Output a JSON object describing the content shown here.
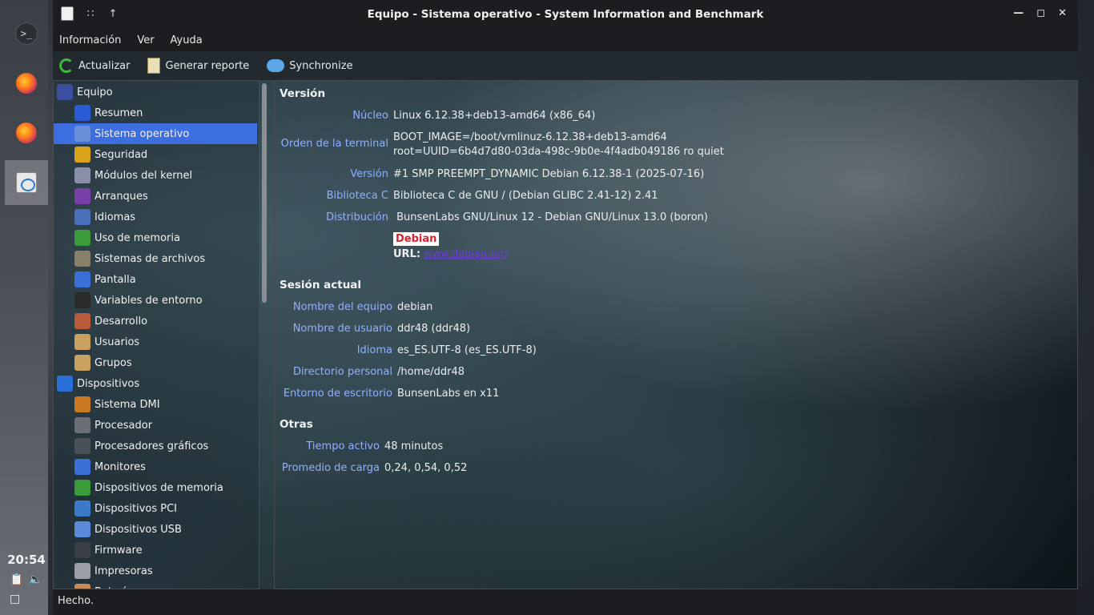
{
  "dock": {
    "clock": "20:54"
  },
  "window": {
    "title": "Equipo - Sistema operativo - System Information and Benchmark"
  },
  "menu": [
    "Información",
    "Ver",
    "Ayuda"
  ],
  "toolbar": {
    "refresh": "Actualizar",
    "report": "Generar reporte",
    "sync": "Synchronize"
  },
  "tree": [
    {
      "label": "Equipo",
      "level": "cat",
      "icon": "computer-icon",
      "color": "#3b4ea0"
    },
    {
      "label": "Resumen",
      "level": "sub",
      "icon": "info-icon",
      "color": "#2a5bd7"
    },
    {
      "label": "Sistema operativo",
      "level": "sub",
      "icon": "os-icon",
      "color": "#6a8fd8",
      "selected": true
    },
    {
      "label": "Seguridad",
      "level": "sub",
      "icon": "shield-icon",
      "color": "#d9a21b"
    },
    {
      "label": "Módulos del kernel",
      "level": "sub",
      "icon": "module-icon",
      "color": "#8a8fa8"
    },
    {
      "label": "Arranques",
      "level": "sub",
      "icon": "rocket-icon",
      "color": "#7a3fa8"
    },
    {
      "label": "Idiomas",
      "level": "sub",
      "icon": "language-icon",
      "color": "#4a6fb8"
    },
    {
      "label": "Uso de memoria",
      "level": "sub",
      "icon": "memory-icon",
      "color": "#3a9a3a"
    },
    {
      "label": "Sistemas de archivos",
      "level": "sub",
      "icon": "filesystem-icon",
      "color": "#8a7f6a"
    },
    {
      "label": "Pantalla",
      "level": "sub",
      "icon": "display-icon",
      "color": "#3a6fd8"
    },
    {
      "label": "Variables de entorno",
      "level": "sub",
      "icon": "terminal-icon",
      "color": "#2a2a2a"
    },
    {
      "label": "Desarrollo",
      "level": "sub",
      "icon": "development-icon",
      "color": "#b85a3a"
    },
    {
      "label": "Usuarios",
      "level": "sub",
      "icon": "users-icon",
      "color": "#c9a060"
    },
    {
      "label": "Grupos",
      "level": "sub",
      "icon": "groups-icon",
      "color": "#c9a060"
    },
    {
      "label": "Dispositivos",
      "level": "cat",
      "icon": "devices-icon",
      "color": "#2a6fd8"
    },
    {
      "label": "Sistema DMI",
      "level": "sub",
      "icon": "gears-icon",
      "color": "#c97a20"
    },
    {
      "label": "Procesador",
      "level": "sub",
      "icon": "cpu-icon",
      "color": "#6a6f75"
    },
    {
      "label": "Procesadores gráficos",
      "level": "sub",
      "icon": "gpu-icon",
      "color": "#4a5058"
    },
    {
      "label": "Monitores",
      "level": "sub",
      "icon": "monitor-icon",
      "color": "#3a6fd8"
    },
    {
      "label": "Dispositivos de memoria",
      "level": "sub",
      "icon": "memory-device-icon",
      "color": "#3a9a3a"
    },
    {
      "label": "Dispositivos PCI",
      "level": "sub",
      "icon": "pci-icon",
      "color": "#3a7ac8"
    },
    {
      "label": "Dispositivos USB",
      "level": "sub",
      "icon": "usb-icon",
      "color": "#5a8ad8"
    },
    {
      "label": "Firmware",
      "level": "sub",
      "icon": "firmware-icon",
      "color": "#3a3f45"
    },
    {
      "label": "Impresoras",
      "level": "sub",
      "icon": "printer-icon",
      "color": "#9a9fa5"
    },
    {
      "label": "Baterías",
      "level": "sub",
      "icon": "battery-icon",
      "color": "#c98a5a"
    }
  ],
  "info": {
    "version_title": "Versión",
    "nucleo_label": "Núcleo",
    "nucleo_value": "Linux 6.12.38+deb13-amd64 (x86_64)",
    "cmdline_label": "Orden de la terminal",
    "cmdline_line1": "BOOT_IMAGE=/boot/vmlinuz-6.12.38+deb13-amd64",
    "cmdline_line2": "root=UUID=6b4d7d80-03da-498c-9b0e-4f4adb049186 ro quiet",
    "version_label": "Versión",
    "version_value": "#1 SMP PREEMPT_DYNAMIC Debian 6.12.38-1 (2025-07-16)",
    "libc_label": "Biblioteca C",
    "libc_value": "Biblioteca C de GNU / (Debian GLIBC 2.41-12) 2.41",
    "distro_label": "Distribución",
    "distro_value": " BunsenLabs GNU/Linux 12 - Debian GNU/Linux 13.0 (boron)",
    "debian_badge": "Debian",
    "url_label": "URL:",
    "url_value": "www.debian.org",
    "session_title": "Sesión actual",
    "hostname_label": "Nombre del equipo",
    "hostname_value": "debian",
    "username_label": "Nombre de usuario",
    "username_value": "ddr48 (ddr48)",
    "locale_label": "Idioma",
    "locale_value": "es_ES.UTF-8 (es_ES.UTF-8)",
    "home_label": "Directorio personal",
    "home_value": "/home/ddr48",
    "desktop_label": "Entorno de escritorio",
    "desktop_value": "BunsenLabs en x11",
    "other_title": "Otras",
    "uptime_label": "Tiempo activo",
    "uptime_value": "48 minutos",
    "load_label": "Promedio de carga",
    "load_value": "0,24, 0,54, 0,52"
  },
  "status": "Hecho."
}
